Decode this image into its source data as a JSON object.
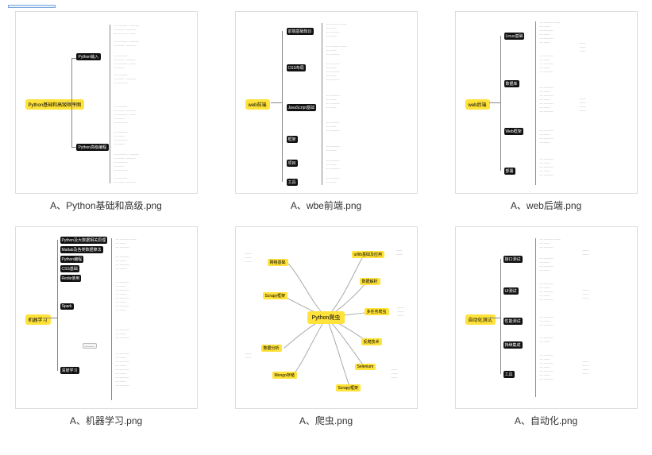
{
  "selection_hint_title": "selection rectangle",
  "files": [
    {
      "label": "A、Python基础和高级.png",
      "root": "Python基础和高级顺序图",
      "topics": [
        "Python输入",
        "Python高级编程"
      ]
    },
    {
      "label": "A、wbe前端.png",
      "root": "web前端",
      "topics": [
        "前端基础知识",
        "CSS布局",
        "JavaScript基础",
        "框架",
        "项目",
        "工具"
      ]
    },
    {
      "label": "A、web后端.png",
      "root": "web后端",
      "topics": [
        "Linux基础",
        "数据库",
        "Web框架",
        "部署"
      ]
    },
    {
      "label": "A、机器学习.png",
      "root": "机器学习",
      "topics": [
        "Python及大数据相关原理",
        "Matlab及各类数据算法",
        "Python编程",
        "CSS基础",
        "Redis使用",
        "Spark",
        "深度学习"
      ]
    },
    {
      "label": "A、爬虫.png",
      "root": "Python爬虫",
      "topics_left": [
        "网络基础",
        "Scrapy框架",
        "数据分析",
        "Mongo存储"
      ],
      "topics_right": [
        "urllib基础及应用",
        "数据解析",
        "多任务爬虫",
        "反爬技术",
        "Selenium",
        "Scrapy框架"
      ]
    },
    {
      "label": "A、自动化.png",
      "root": "自动化测试",
      "topics": [
        "接口测试",
        "UI测试",
        "性能测试",
        "持续集成",
        "工具"
      ]
    }
  ]
}
